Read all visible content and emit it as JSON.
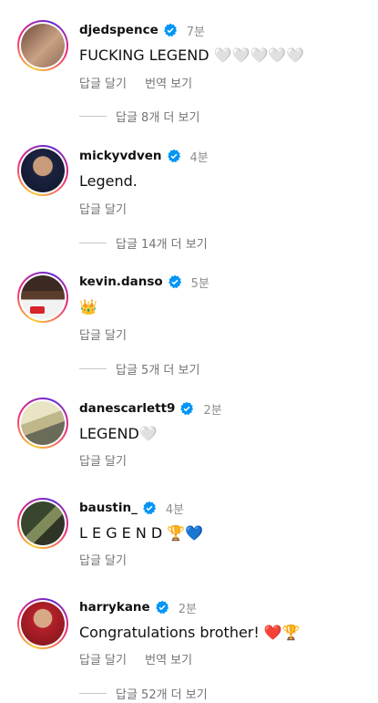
{
  "comments": [
    {
      "username": "djedspence",
      "time": "7분",
      "text": "FUCKING LEGEND 🤍🤍🤍🤍🤍",
      "reply": "답글 달기",
      "translate": "번역 보기",
      "more_replies": "답글 8개 더 보기"
    },
    {
      "username": "mickyvdven",
      "time": "4분",
      "text": "Legend.",
      "reply": "답글 달기",
      "more_replies": "답글 14개 더 보기"
    },
    {
      "username": "kevin.danso",
      "time": "5분",
      "text": "👑",
      "reply": "답글 달기",
      "more_replies": "답글 5개 더 보기"
    },
    {
      "username": "danescarlett9",
      "time": "2분",
      "text": "LEGEND🤍",
      "reply": "답글 달기"
    },
    {
      "username": "baustin_",
      "time": "4분",
      "text": "L E G E N D 🏆💙",
      "reply": "답글 달기"
    },
    {
      "username": "harrykane",
      "time": "2분",
      "text": "Congratulations brother! ❤️🏆",
      "reply": "답글 달기",
      "translate": "번역 보기",
      "more_replies": "답글 52개 더 보기"
    }
  ],
  "icons": {
    "verified": "verified-badge-icon"
  },
  "colors": {
    "verified_blue": "#0095f6",
    "secondary_text": "#737373",
    "story_ring_start": "#f9ce34",
    "story_ring_end": "#ee2a7b"
  }
}
